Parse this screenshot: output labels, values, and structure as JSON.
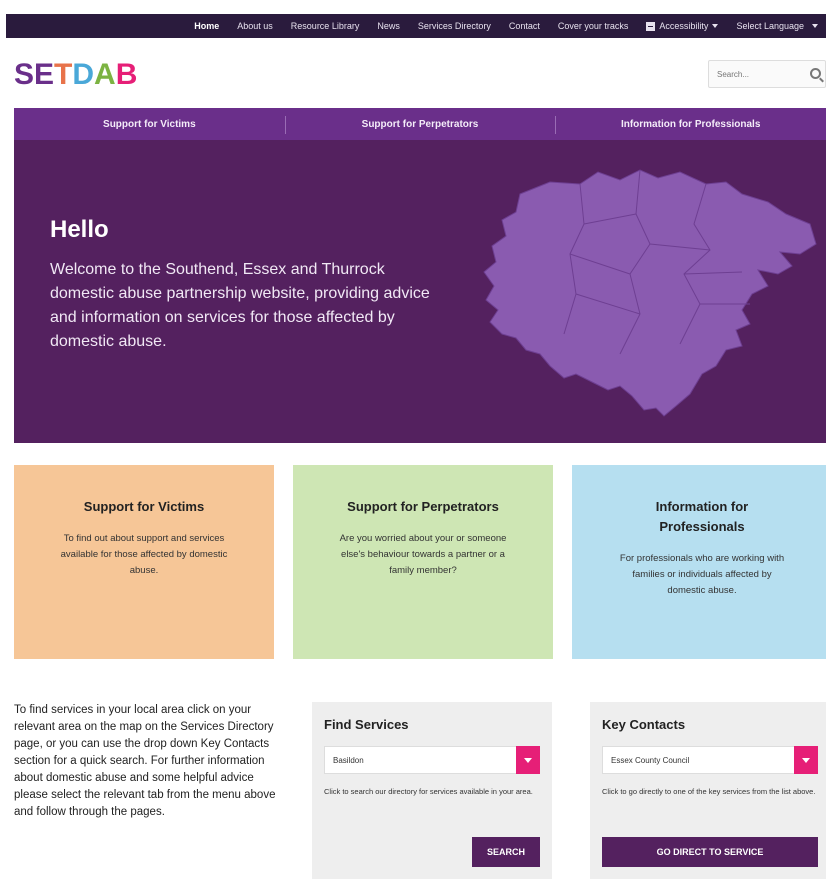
{
  "topnav": {
    "items": [
      {
        "label": "Home",
        "active": true
      },
      {
        "label": "About us"
      },
      {
        "label": "Resource Library"
      },
      {
        "label": "News"
      },
      {
        "label": "Services Directory"
      },
      {
        "label": "Contact"
      },
      {
        "label": "Cover your tracks"
      }
    ],
    "accessibility": "Accessibility",
    "language": "Select Language"
  },
  "header": {
    "logo_letters": [
      "S",
      "E",
      "T",
      "D",
      "A",
      "B"
    ],
    "logo_colors": [
      "#6a2f8a",
      "#6a2f8a",
      "#e8734a",
      "#4aa8d8",
      "#7cb342",
      "#e61f77"
    ],
    "search_placeholder": "Search..."
  },
  "mainnav": {
    "items": [
      "Support for Victims",
      "Support for Perpetrators",
      "Information for Professionals"
    ]
  },
  "hero": {
    "title": "Hello",
    "text": "Welcome to the Southend, Essex and Thurrock domestic abuse partnership website, providing advice and information on services for those affected by domestic abuse."
  },
  "cards": [
    {
      "title": "Support for Victims",
      "text": "To find out about support and services available for those affected by domestic abuse.",
      "color": "#f6c697"
    },
    {
      "title": "Support for Perpetrators",
      "text": "Are you worried about your or someone else's behaviour towards a partner or a family member?",
      "color": "#cee6b4"
    },
    {
      "title": "Information for Professionals",
      "text": "For professionals who are working with families or individuals affected by domestic abuse.",
      "color": "#b6dff0"
    }
  ],
  "intro": "To find services in your local area click on your relevant area on the map on the Services Directory page, or you can use the drop down Key Contacts section for a quick search. For further information about domestic abuse and some helpful advice please select the relevant tab from the menu above and follow through the pages.",
  "find_services": {
    "title": "Find Services",
    "selected": "Basildon",
    "hint": "Click to search our directory for services available in your area.",
    "button": "SEARCH"
  },
  "key_contacts": {
    "title": "Key Contacts",
    "selected": "Essex County Council",
    "hint": "Click to go directly to one of the key services from the list above.",
    "button": "GO DIRECT TO SERVICE"
  },
  "colors": {
    "brand_purple": "#54215f",
    "nav_purple": "#6a2f8a",
    "accent_pink": "#e61f77",
    "map_purple": "#8a5bb0"
  }
}
